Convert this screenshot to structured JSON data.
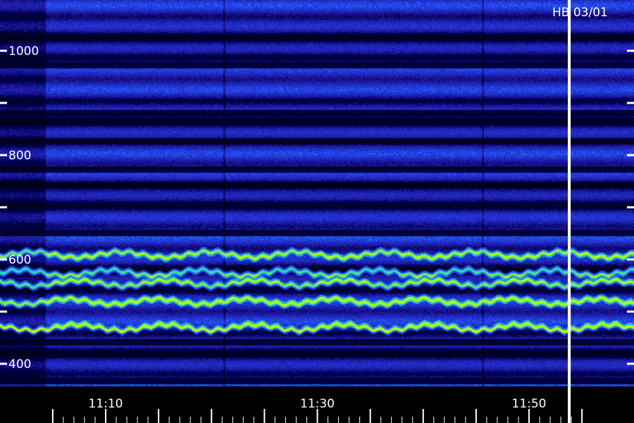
{
  "header": {
    "station_label": "HB 03/01"
  },
  "chart_data": {
    "type": "heatmap",
    "title": "",
    "xlabel": "",
    "ylabel": "",
    "x_ticks": [
      {
        "label": "11:10",
        "value": 0
      },
      {
        "label": "11:30",
        "value": 20
      },
      {
        "label": "11:50",
        "value": 40
      }
    ],
    "x_minor_step_minutes": 5,
    "xlim_minutes": [
      -5,
      45
    ],
    "y_ticks": [
      {
        "label": "400",
        "value": 400
      },
      {
        "label": "600",
        "value": 600
      },
      {
        "label": "800",
        "value": 800
      },
      {
        "label": "1000",
        "value": 1000
      }
    ],
    "y_minor_step": 100,
    "ylim": [
      370,
      1070
    ],
    "marker_time_minutes": 43.8,
    "bright_bands": [
      {
        "center": 470,
        "level": "high"
      },
      {
        "center": 520,
        "level": "medium"
      },
      {
        "center": 555,
        "level": "medium"
      },
      {
        "center": 575,
        "level": "medium"
      },
      {
        "center": 610,
        "level": "medium"
      }
    ],
    "colormap": [
      "#000010",
      "#1a10a0",
      "#2030e0",
      "#2060ff",
      "#20c0e0",
      "#a0f020"
    ]
  }
}
